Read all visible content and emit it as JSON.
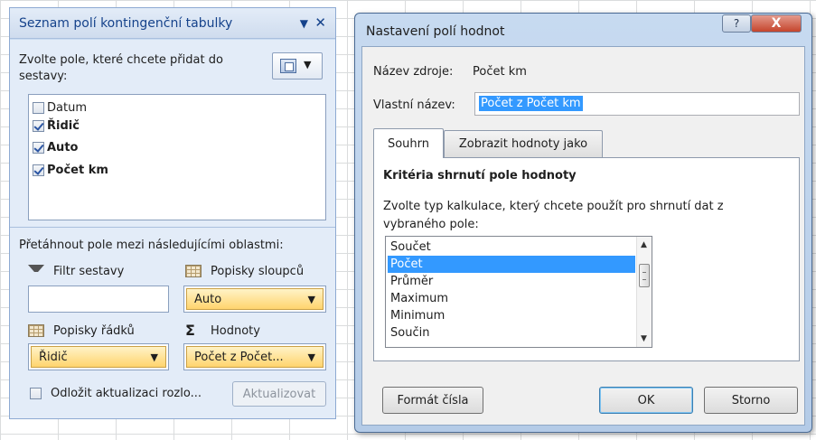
{
  "field_list": {
    "title": "Seznam polí kontingenční tabulky",
    "dropdown_glyph": "▼",
    "close_glyph": "✕",
    "prompt": "Zvolte pole, které chcete přidat do sestavy:",
    "layout_dropdown_glyph": "▼",
    "fields": [
      {
        "label": "Datum",
        "checked": false
      },
      {
        "label": "Řidič",
        "checked": true
      },
      {
        "label": "Auto",
        "checked": true
      },
      {
        "label": "Počet km",
        "checked": true
      }
    ],
    "areas_title": "Přetáhnout pole mezi následujícími oblastmi:",
    "areas": {
      "filter": {
        "label": "Filtr sestavy",
        "icon": "funnel-icon"
      },
      "columns": {
        "label": "Popisky sloupců",
        "icon": "grid-icon",
        "item": "Auto"
      },
      "rows": {
        "label": "Popisky řádků",
        "icon": "grid-icon",
        "item": "Řidič"
      },
      "values": {
        "label": "Hodnoty",
        "icon": "sigma-icon",
        "symbol": "Σ",
        "item": "Počet z Počet..."
      }
    },
    "chip_dropdown_glyph": "▼",
    "defer_label": "Odložit aktualizaci rozlo...",
    "update_button": "Aktualizovat"
  },
  "dialog": {
    "title": "Nastavení polí hodnot",
    "help_glyph": "?",
    "close_glyph": "X",
    "source_label": "Název zdroje:",
    "source_value": "Počet km",
    "custom_name_label": "Vlastní název:",
    "custom_name_value": "Počet z Počet km",
    "tabs": [
      {
        "label": "Souhrn",
        "active": true
      },
      {
        "label": "Zobrazit hodnoty jako",
        "active": false
      }
    ],
    "group_title": "Kritéria shrnutí pole hodnoty",
    "group_text": "Zvolte typ kalkulace, který chcete použít pro shrnutí dat z vybraného pole:",
    "functions": [
      "Součet",
      "Počet",
      "Průměr",
      "Maximum",
      "Minimum",
      "Součin"
    ],
    "selected_function": "Počet",
    "scroll_up_glyph": "▲",
    "scroll_down_glyph": "▼",
    "number_format_button": "Formát čísla",
    "ok_button": "OK",
    "cancel_button": "Storno"
  }
}
